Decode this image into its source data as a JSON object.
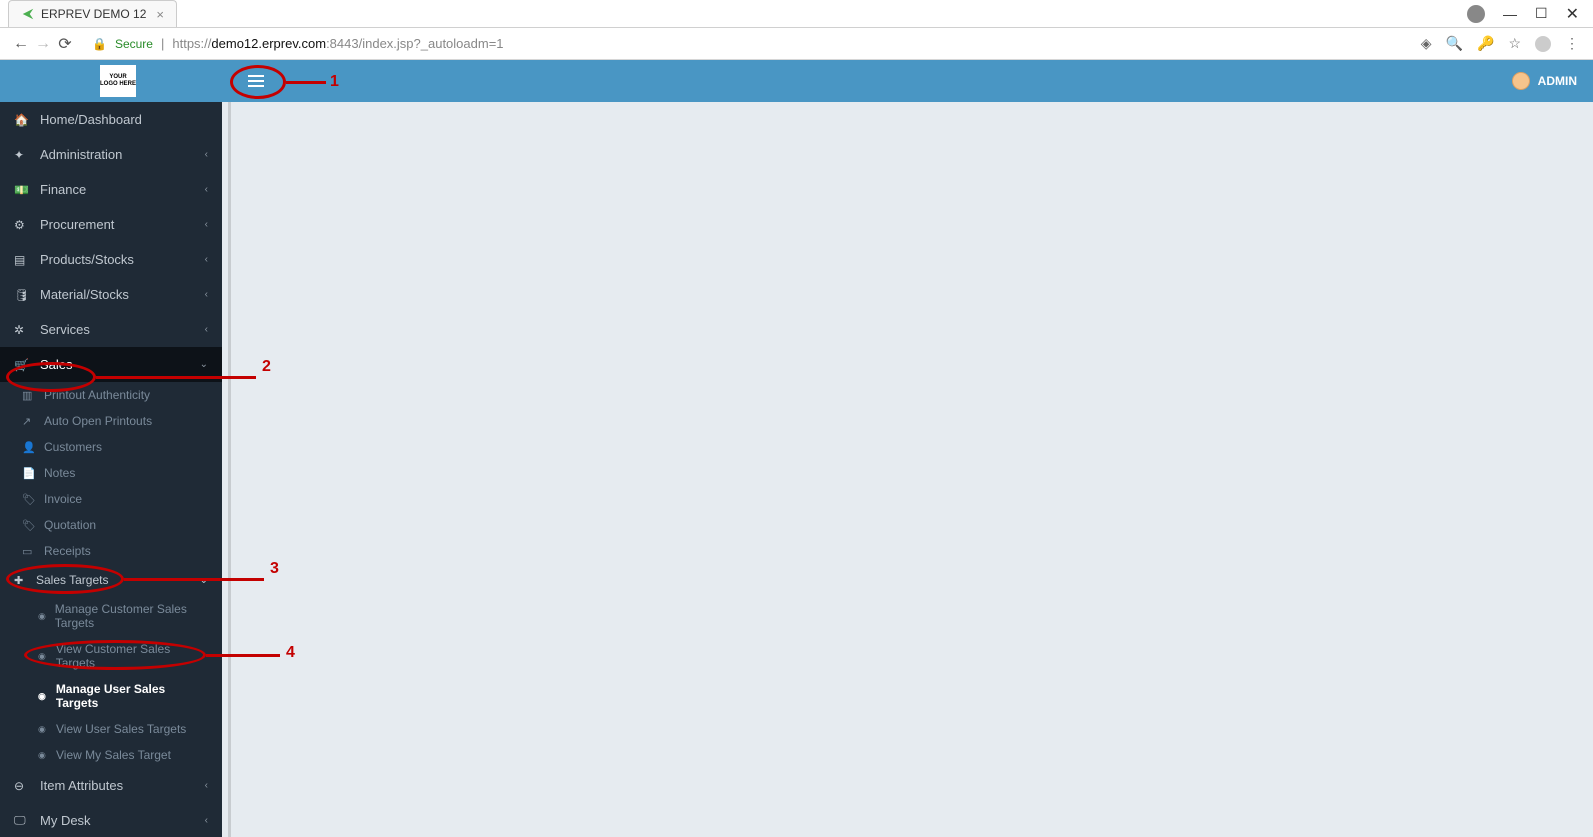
{
  "browser": {
    "tab_title": "ERPREV DEMO 12",
    "secure_label": "Secure",
    "url_prefix": "https://",
    "url_host": "demo12.erprev.com",
    "url_port": ":8443",
    "url_path": "/index.jsp?_autoloadm=1"
  },
  "header": {
    "logo_text": "YOUR LOGO HERE",
    "user_name": "ADMIN"
  },
  "sidebar": {
    "items": [
      {
        "label": "Home/Dashboard",
        "icon": "⌕",
        "expandable": false
      },
      {
        "label": "Administration",
        "icon": "✦",
        "expandable": true
      },
      {
        "label": "Finance",
        "icon": "▭",
        "expandable": true
      },
      {
        "label": "Procurement",
        "icon": "⚙",
        "expandable": true
      },
      {
        "label": "Products/Stocks",
        "icon": "▤",
        "expandable": true
      },
      {
        "label": "Material/Stocks",
        "icon": "♥",
        "expandable": true
      },
      {
        "label": "Services",
        "icon": "✲",
        "expandable": true
      },
      {
        "label": "Sales",
        "icon": "🛒",
        "expandable": true
      }
    ],
    "sales_sub": [
      {
        "label": "Printout Authenticity",
        "icon": "▥"
      },
      {
        "label": "Auto Open Printouts",
        "icon": "↗"
      },
      {
        "label": "Customers",
        "icon": "👤"
      },
      {
        "label": "Notes",
        "icon": "📄"
      },
      {
        "label": "Invoice",
        "icon": "🏷"
      },
      {
        "label": "Quotation",
        "icon": "🏷"
      },
      {
        "label": "Receipts",
        "icon": "▭"
      }
    ],
    "sales_targets_label": "Sales Targets",
    "sales_targets_icon": "✚",
    "targets_sub": [
      {
        "label": "Manage Customer Sales Targets"
      },
      {
        "label": "View Customer Sales Targets"
      },
      {
        "label": "Manage User Sales Targets"
      },
      {
        "label": "View User Sales Targets"
      },
      {
        "label": "View My Sales Target"
      }
    ],
    "bottom_items": [
      {
        "label": "Item Attributes",
        "icon": "⊖"
      },
      {
        "label": "My Desk",
        "icon": "🖵"
      }
    ]
  },
  "annotations": {
    "n1": "1",
    "n2": "2",
    "n3": "3",
    "n4": "4"
  }
}
